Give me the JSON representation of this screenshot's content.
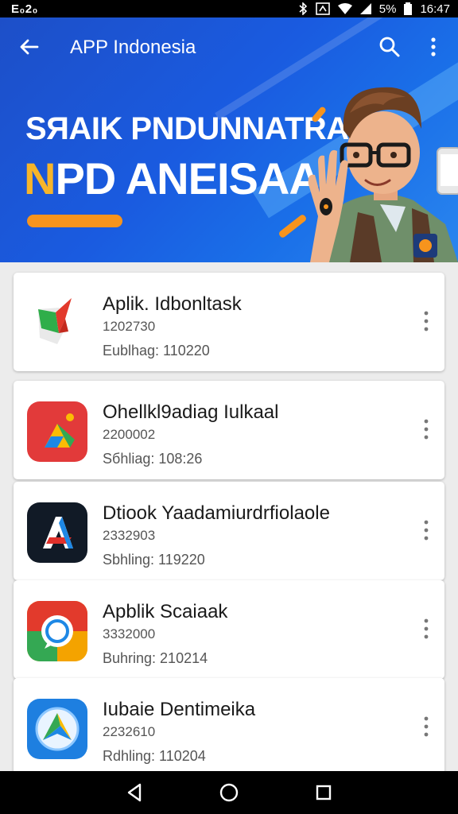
{
  "status_bar": {
    "left_text": "E₀2₀",
    "battery": "5%",
    "time": "16:47",
    "icons": [
      "bluetooth-icon",
      "nfc-icon",
      "wifi-icon",
      "signal-icon",
      "battery-icon"
    ]
  },
  "app_bar": {
    "title": "APP Indonesia",
    "icons": [
      "back-arrow-icon",
      "search-icon",
      "more-vert-icon"
    ]
  },
  "banner": {
    "line1": "SЯAIK PNDUNNATRAA",
    "line2_first": "N",
    "line2_rest": "PD ANEISAA",
    "colors": {
      "accent": "#f7941d",
      "highlight": "#f7b52a",
      "background": "#1a5be0"
    }
  },
  "apps": [
    {
      "title": "Aplik. Idbonltask",
      "code": "1202730",
      "date": "Eublhag: 110220",
      "icon": "green-red-flag-icon"
    },
    {
      "title": "Ohellkl9adiag Iulkaal",
      "code": "2200002",
      "date": "Sбhliag: 108:26",
      "icon": "drive-triangle-icon"
    },
    {
      "title": "Dtiook Yaadamiurdrfiolaole",
      "code": "2332903",
      "date": "Sbhling: 119220",
      "icon": "letter-a-icon"
    },
    {
      "title": "Apblik Scaiaak",
      "code": "3332000",
      "date": "Buhring: 210214",
      "icon": "chat-bubble-icon"
    },
    {
      "title": "Iubaie Dentimeika",
      "code": "2232610",
      "date": "Rdhling: 110204",
      "icon": "compass-arrow-icon"
    }
  ],
  "nav_bar": {
    "icons": [
      "back-triangle-icon",
      "home-circle-icon",
      "recents-square-icon"
    ]
  }
}
